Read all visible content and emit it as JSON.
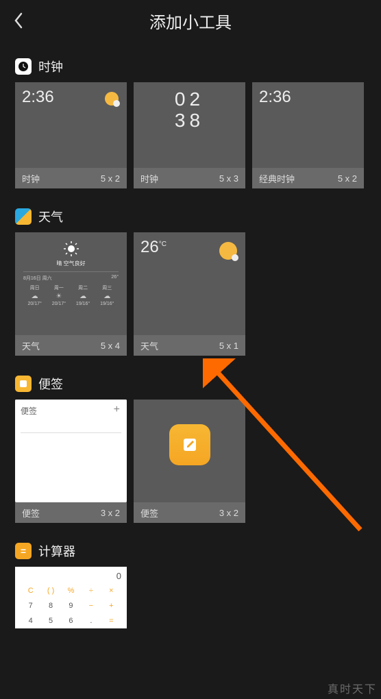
{
  "header": {
    "title": "添加小工具"
  },
  "sections": {
    "clock": {
      "title": "时钟",
      "widgets": [
        {
          "name": "时钟",
          "size": "5 x 2",
          "time": "2:36"
        },
        {
          "name": "时钟",
          "size": "5 x 3",
          "time_top": "02",
          "time_bottom": "38"
        },
        {
          "name": "经典时钟",
          "size": "5 x 2",
          "time": "2:36"
        }
      ]
    },
    "weather": {
      "title": "天气",
      "widgets": [
        {
          "name": "天气",
          "size": "5 x 4",
          "condition": "晴 空气良好",
          "date": "8月16日 周六",
          "temp": "26°",
          "forecast": [
            {
              "day": "周日",
              "t": "20/17°"
            },
            {
              "day": "周一",
              "t": "20/17°"
            },
            {
              "day": "周二",
              "t": "19/16°"
            },
            {
              "day": "周三",
              "t": "19/16°"
            }
          ]
        },
        {
          "name": "天气",
          "size": "5 x 1",
          "temp": "26",
          "unit": "°C"
        }
      ]
    },
    "notes": {
      "title": "便签",
      "widgets": [
        {
          "name": "便签",
          "size": "3 x 2",
          "inner_label": "便签"
        },
        {
          "name": "便签",
          "size": "3 x 2"
        }
      ]
    },
    "calculator": {
      "title": "计算器",
      "display": "0",
      "keys_row1": [
        "C",
        "( )",
        "%",
        "÷",
        "×"
      ],
      "keys_row2": [
        "7",
        "8",
        "9",
        "−",
        "+"
      ],
      "keys_row3": [
        "4",
        "5",
        "6",
        ".",
        "="
      ]
    }
  },
  "watermark": "真时天下"
}
